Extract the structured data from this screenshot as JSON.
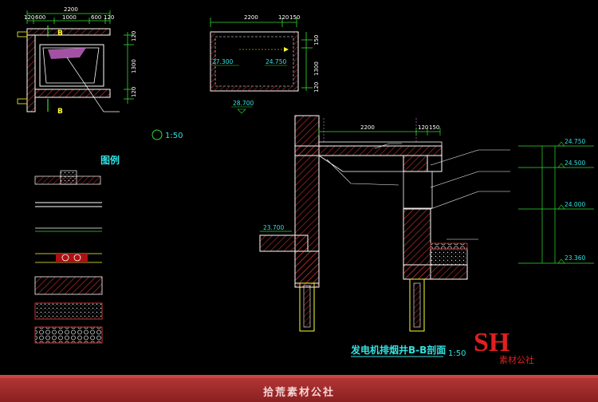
{
  "top_left_plan": {
    "overall_dim": "2200",
    "sub_dims": [
      "120",
      "600",
      "1000",
      "600",
      "120"
    ],
    "side_dims": [
      "120",
      "1300",
      "120"
    ],
    "section_marks": [
      "B",
      "B"
    ]
  },
  "top_right_plan": {
    "overall_dim": "2200",
    "sub_dims": [
      "120",
      "150"
    ],
    "side_dims": [
      "150",
      "1300",
      "120"
    ],
    "levels": [
      "27.300",
      "24.750",
      "28.700"
    ]
  },
  "scale_note": "1:50",
  "legend": {
    "title": "图例"
  },
  "section": {
    "levels": [
      "24.750",
      "24.500",
      "24.000",
      "23.360",
      "23.700"
    ],
    "dims": [
      "2200",
      "120",
      "150"
    ],
    "title": "发电机排烟井B-B剖面",
    "scale": "1:50"
  },
  "watermark": {
    "logo": "SH",
    "sub": "素材公社"
  },
  "footer": {
    "text": "拾荒素材公社"
  },
  "colors": {
    "background": "#000000",
    "wall": "#ffffff",
    "dimension": "#33dd33",
    "text": "#33e0e0",
    "highlight": "#ffff33",
    "accent": "#e02020",
    "footer": "#9b2a2a"
  }
}
